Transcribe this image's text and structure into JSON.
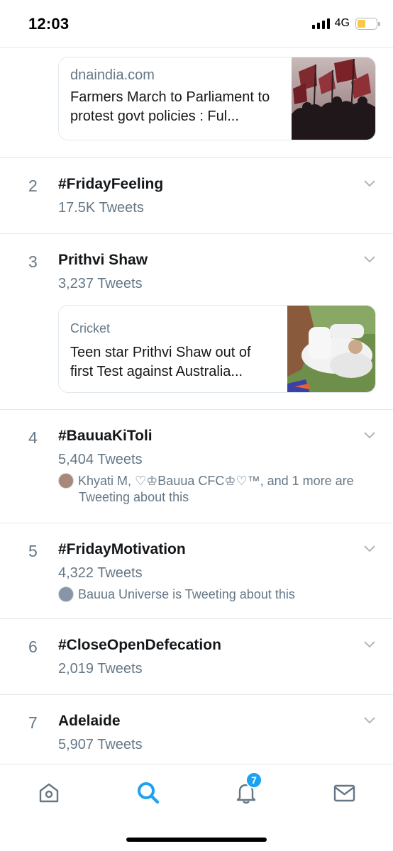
{
  "status_bar": {
    "time": "12:03",
    "network": "4G"
  },
  "top_card": {
    "source": "dnaindia.com",
    "headline": "Farmers March to Parliament to protest govt policies : Ful..."
  },
  "trends": [
    {
      "rank": "2",
      "name": "#FridayFeeling",
      "count": "17.5K Tweets"
    },
    {
      "rank": "3",
      "name": "Prithvi Shaw",
      "count": "3,237 Tweets",
      "card": {
        "source": "Cricket",
        "headline": "Teen star Prithvi Shaw out of first Test against Australia..."
      }
    },
    {
      "rank": "4",
      "name": "#BauuaKiToli",
      "count": "5,404 Tweets",
      "social_line1": "Khyati M, ♡♔Bauua CFC♔♡™, and 1 more are",
      "social_line2": "Tweeting about this"
    },
    {
      "rank": "5",
      "name": "#FridayMotivation",
      "count": "4,322 Tweets",
      "social_line1": "Bauua Universe is Tweeting about this"
    },
    {
      "rank": "6",
      "name": "#CloseOpenDefecation",
      "count": "2,019 Tweets"
    },
    {
      "rank": "7",
      "name": "Adelaide",
      "count": "5,907 Tweets"
    }
  ],
  "tab_bar": {
    "tabs": [
      {
        "name": "home",
        "icon": "home-icon"
      },
      {
        "name": "search",
        "icon": "search-icon",
        "active": true
      },
      {
        "name": "notifications",
        "icon": "bell-icon"
      },
      {
        "name": "messages",
        "icon": "mail-icon"
      }
    ],
    "notification_badge": "7"
  },
  "colors": {
    "accent": "#1da1f2",
    "secondary_text": "#657786",
    "divider": "#e1e8ed"
  }
}
